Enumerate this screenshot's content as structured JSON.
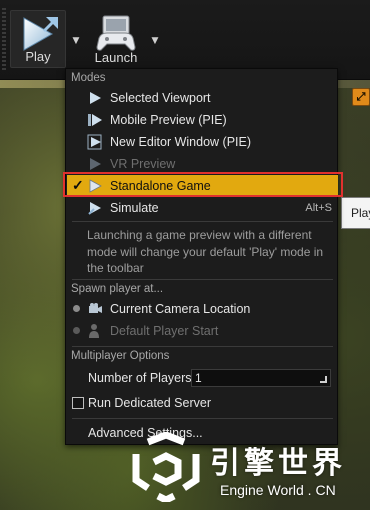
{
  "toolbar": {
    "play_label": "Play",
    "launch_label": "Launch"
  },
  "tooltip": {
    "text": "Play"
  },
  "menu": {
    "modes_title": "Modes",
    "modes": [
      {
        "label": "Selected Viewport",
        "icon": "play-icon",
        "enabled": true
      },
      {
        "label": "Mobile Preview (PIE)",
        "icon": "mobile-play-icon",
        "enabled": true
      },
      {
        "label": "New Editor Window (PIE)",
        "icon": "window-play-icon",
        "enabled": true
      },
      {
        "label": "VR Preview",
        "icon": "vr-play-icon",
        "enabled": false
      },
      {
        "label": "Standalone Game",
        "icon": "standalone-play-icon",
        "enabled": true,
        "selected": true,
        "check": "✓"
      },
      {
        "label": "Simulate",
        "icon": "simulate-icon",
        "enabled": true,
        "shortcut": "Alt+S"
      }
    ],
    "description": "Launching a game preview with a different mode will change your default 'Play' mode in the toolbar",
    "spawn_title": "Spawn player at...",
    "spawn": [
      {
        "label": "Current Camera Location",
        "icon": "camera-icon",
        "enabled": true
      },
      {
        "label": "Default Player Start",
        "icon": "player-start-icon",
        "enabled": false
      }
    ],
    "multiplayer_title": "Multiplayer Options",
    "num_players_label": "Number of Players",
    "num_players_value": "1",
    "dedicated_server_label": "Run Dedicated Server",
    "dedicated_server_checked": false,
    "advanced_label": "Advanced Settings..."
  },
  "watermark": {
    "title": "引擎世界",
    "subtitle": "Engine World . CN"
  },
  "colors": {
    "accent": "#e2a90f",
    "highlight_outline": "#e1312e",
    "menu_bg": "#1c1c1c"
  }
}
